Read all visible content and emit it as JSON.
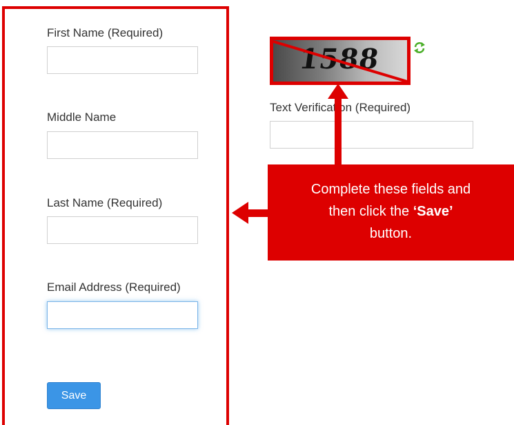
{
  "form": {
    "first_name_label": "First Name (Required)",
    "middle_name_label": "Middle Name",
    "last_name_label": "Last Name (Required)",
    "email_label": "Email Address (Required)",
    "first_name_value": "",
    "middle_name_value": "",
    "last_name_value": "",
    "email_value": "",
    "save_label": "Save"
  },
  "captcha": {
    "image_text": "1588",
    "verification_label": "Text Verification (Required)",
    "verification_value": "",
    "refresh_icon": "refresh-icon"
  },
  "callout": {
    "line1": "Complete these fields and",
    "line2_pre": "then click the ",
    "line2_bold": "‘Save’",
    "line3": "button."
  },
  "colors": {
    "highlight": "#dd0000",
    "save_button": "#3b95e6"
  }
}
